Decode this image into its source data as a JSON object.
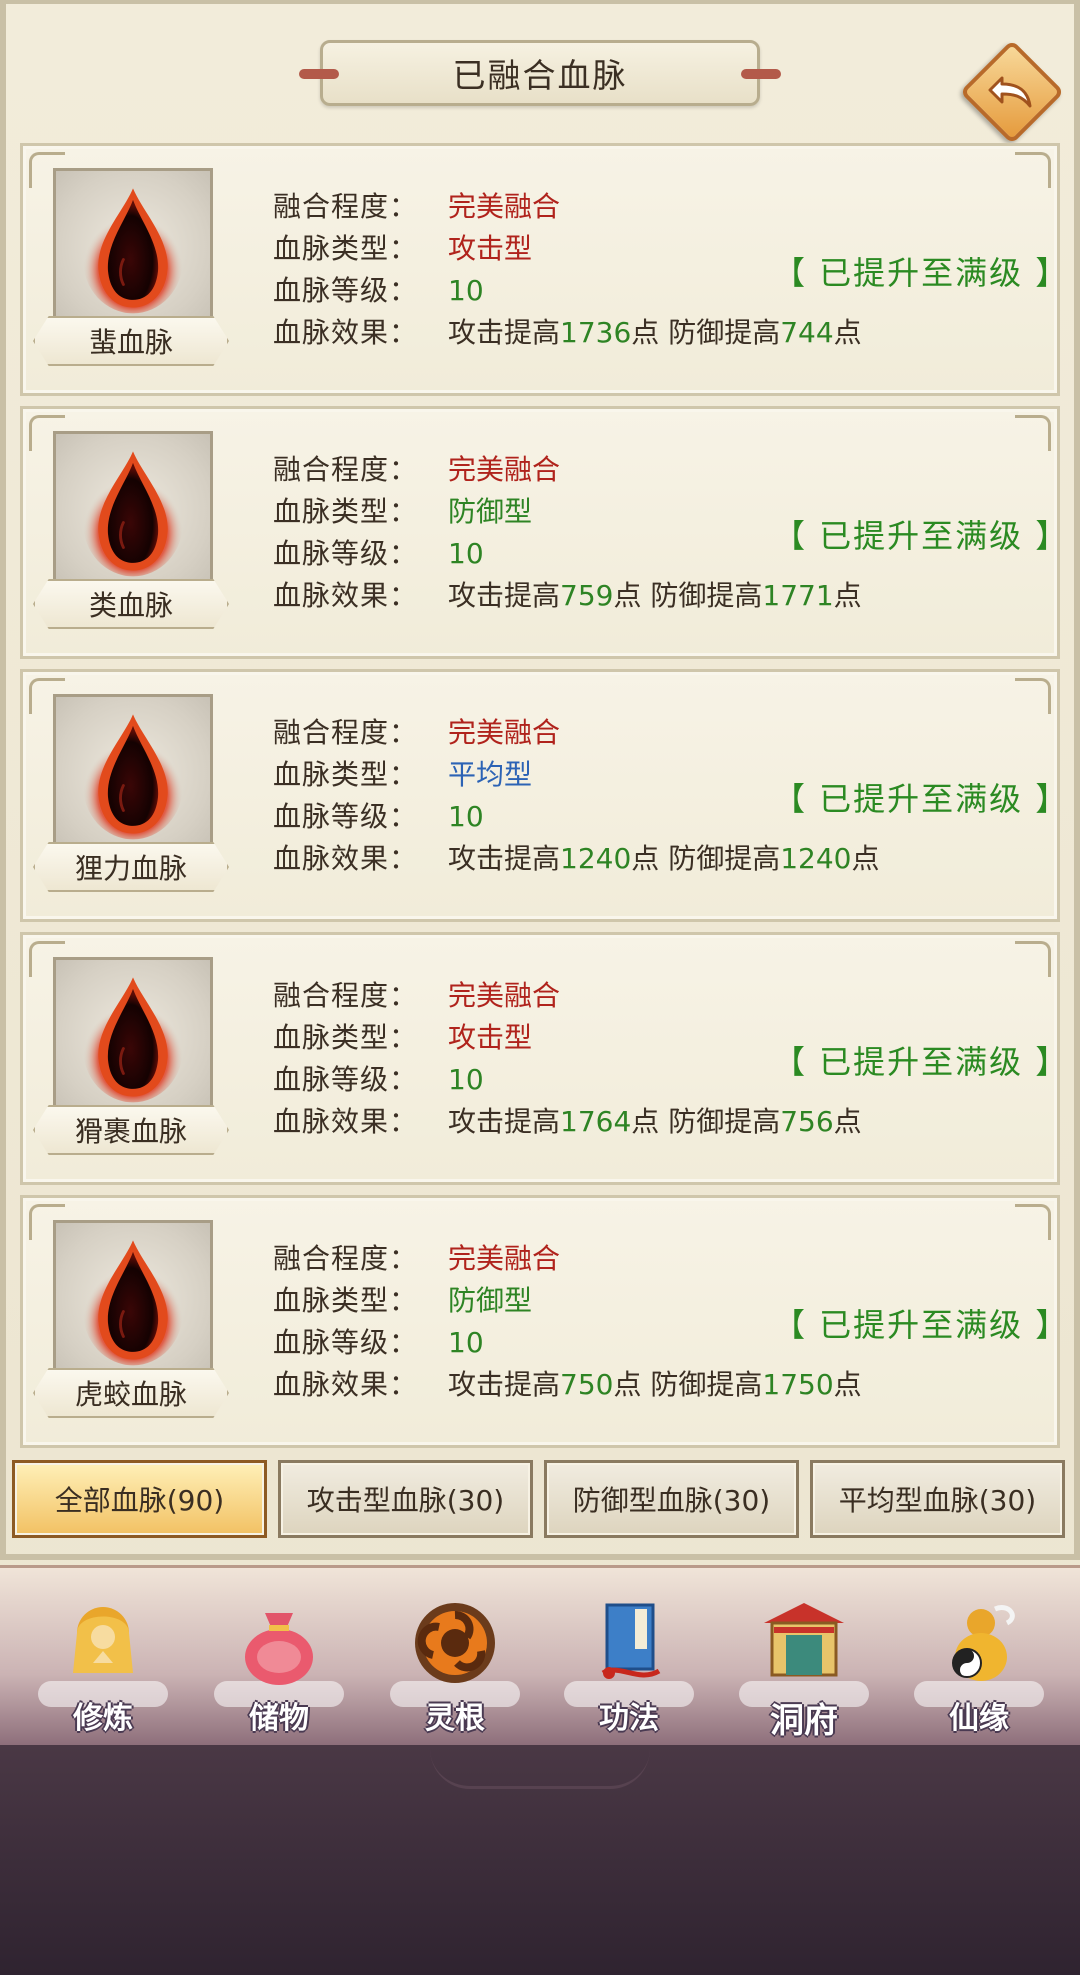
{
  "header": {
    "title": "已融合血脉"
  },
  "labels": {
    "fusion": "融合程度：",
    "type": "血脉类型：",
    "level": "血脉等级：",
    "effect": "血脉效果："
  },
  "bloodlines": [
    {
      "name": "蜚血脉",
      "fusion": "完美融合",
      "type": "攻击型",
      "type_color": "red",
      "level": "10",
      "effect_atk_prefix": "攻击提高",
      "atk": "1736",
      "point1": "点",
      "effect_def_prefix": "防御提高",
      "def": "744",
      "point2": "点",
      "status": "【 已提升至满级 】"
    },
    {
      "name": "类血脉",
      "fusion": "完美融合",
      "type": "防御型",
      "type_color": "green",
      "level": "10",
      "effect_atk_prefix": "攻击提高",
      "atk": "759",
      "point1": "点",
      "effect_def_prefix": "防御提高",
      "def": "1771",
      "point2": "点",
      "status": "【 已提升至满级 】"
    },
    {
      "name": "狸力血脉",
      "fusion": "完美融合",
      "type": "平均型",
      "type_color": "blue",
      "level": "10",
      "effect_atk_prefix": "攻击提高",
      "atk": "1240",
      "point1": "点",
      "effect_def_prefix": "防御提高",
      "def": "1240",
      "point2": "点",
      "status": "【 已提升至满级 】"
    },
    {
      "name": "猾裹血脉",
      "fusion": "完美融合",
      "type": "攻击型",
      "type_color": "red",
      "level": "10",
      "effect_atk_prefix": "攻击提高",
      "atk": "1764",
      "point1": "点",
      "effect_def_prefix": "防御提高",
      "def": "756",
      "point2": "点",
      "status": "【 已提升至满级 】"
    },
    {
      "name": "虎蛟血脉",
      "fusion": "完美融合",
      "type": "防御型",
      "type_color": "green",
      "level": "10",
      "effect_atk_prefix": "攻击提高",
      "atk": "750",
      "point1": "点",
      "effect_def_prefix": "防御提高",
      "def": "1750",
      "point2": "点",
      "status": "【 已提升至满级 】"
    }
  ],
  "tabs": [
    {
      "label": "全部血脉(90)",
      "active": true
    },
    {
      "label": "攻击型血脉(30)",
      "active": false
    },
    {
      "label": "防御型血脉(30)",
      "active": false
    },
    {
      "label": "平均型血脉(30)",
      "active": false
    }
  ],
  "nav": [
    {
      "label": "修炼",
      "icon": "cultivation-monk-icon"
    },
    {
      "label": "储物",
      "icon": "storage-bag-icon"
    },
    {
      "label": "灵根",
      "icon": "spirit-root-icon"
    },
    {
      "label": "功法",
      "icon": "technique-book-icon"
    },
    {
      "label": "洞府",
      "icon": "cave-mansion-icon"
    },
    {
      "label": "仙缘",
      "icon": "immortal-fate-gourd-icon"
    }
  ],
  "colors": {
    "red": "#b0231c",
    "green": "#2e8424",
    "blue": "#2c63b5",
    "status_green": "#2b8a22"
  }
}
